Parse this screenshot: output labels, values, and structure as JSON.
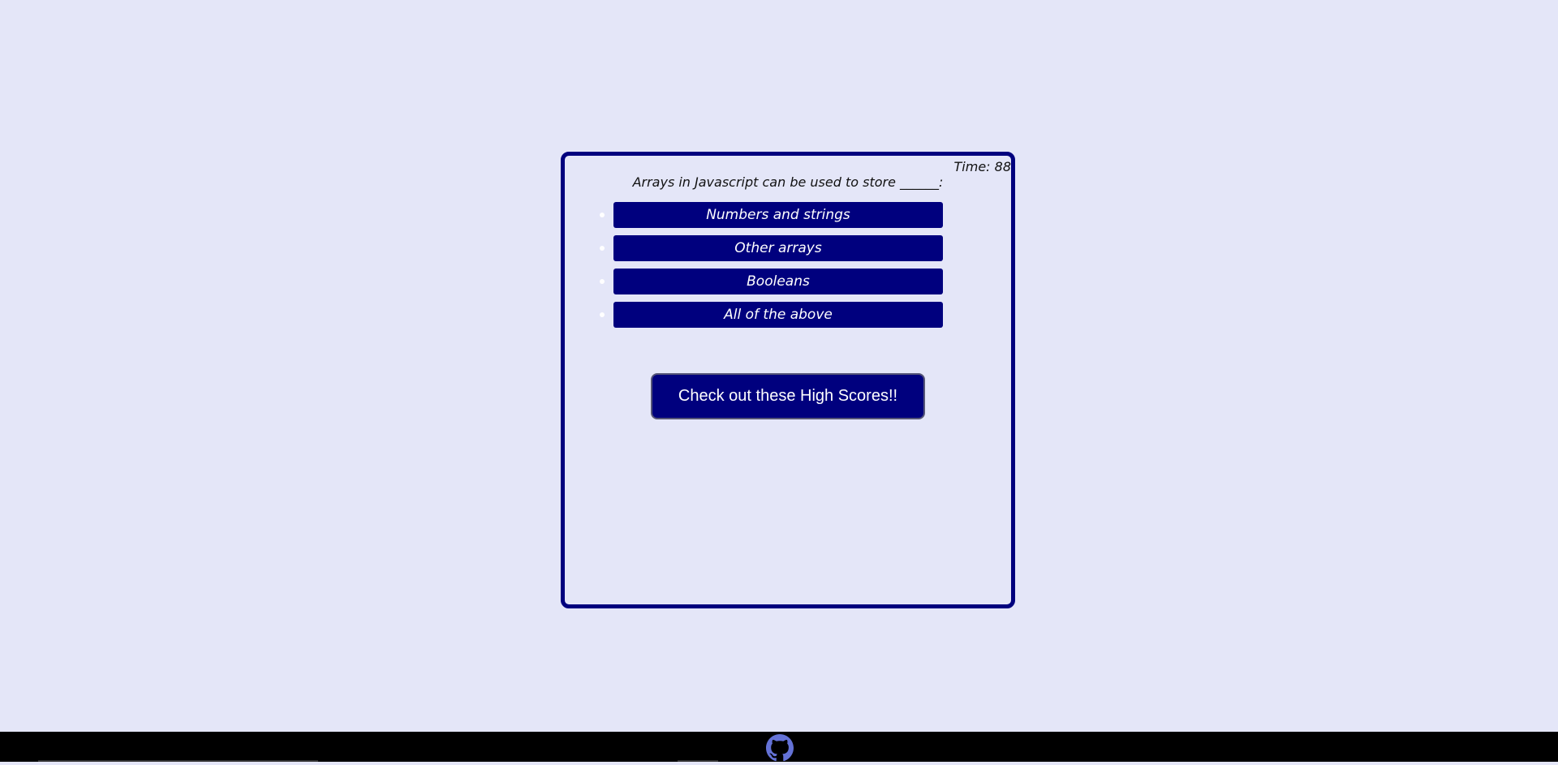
{
  "quiz": {
    "timer": "Time: 88",
    "question": "Arrays in Javascript can be used to store ______:",
    "answers": [
      "Numbers and strings",
      "Other arrays",
      "Booleans",
      "All of the above"
    ],
    "highscores_label": "Check out these High Scores!!"
  },
  "footer": {
    "icon": "github-icon"
  },
  "colors": {
    "background": "#e4e6f8",
    "accent": "#00007e",
    "footer": "#000000",
    "github_icon": "#6472d6"
  }
}
